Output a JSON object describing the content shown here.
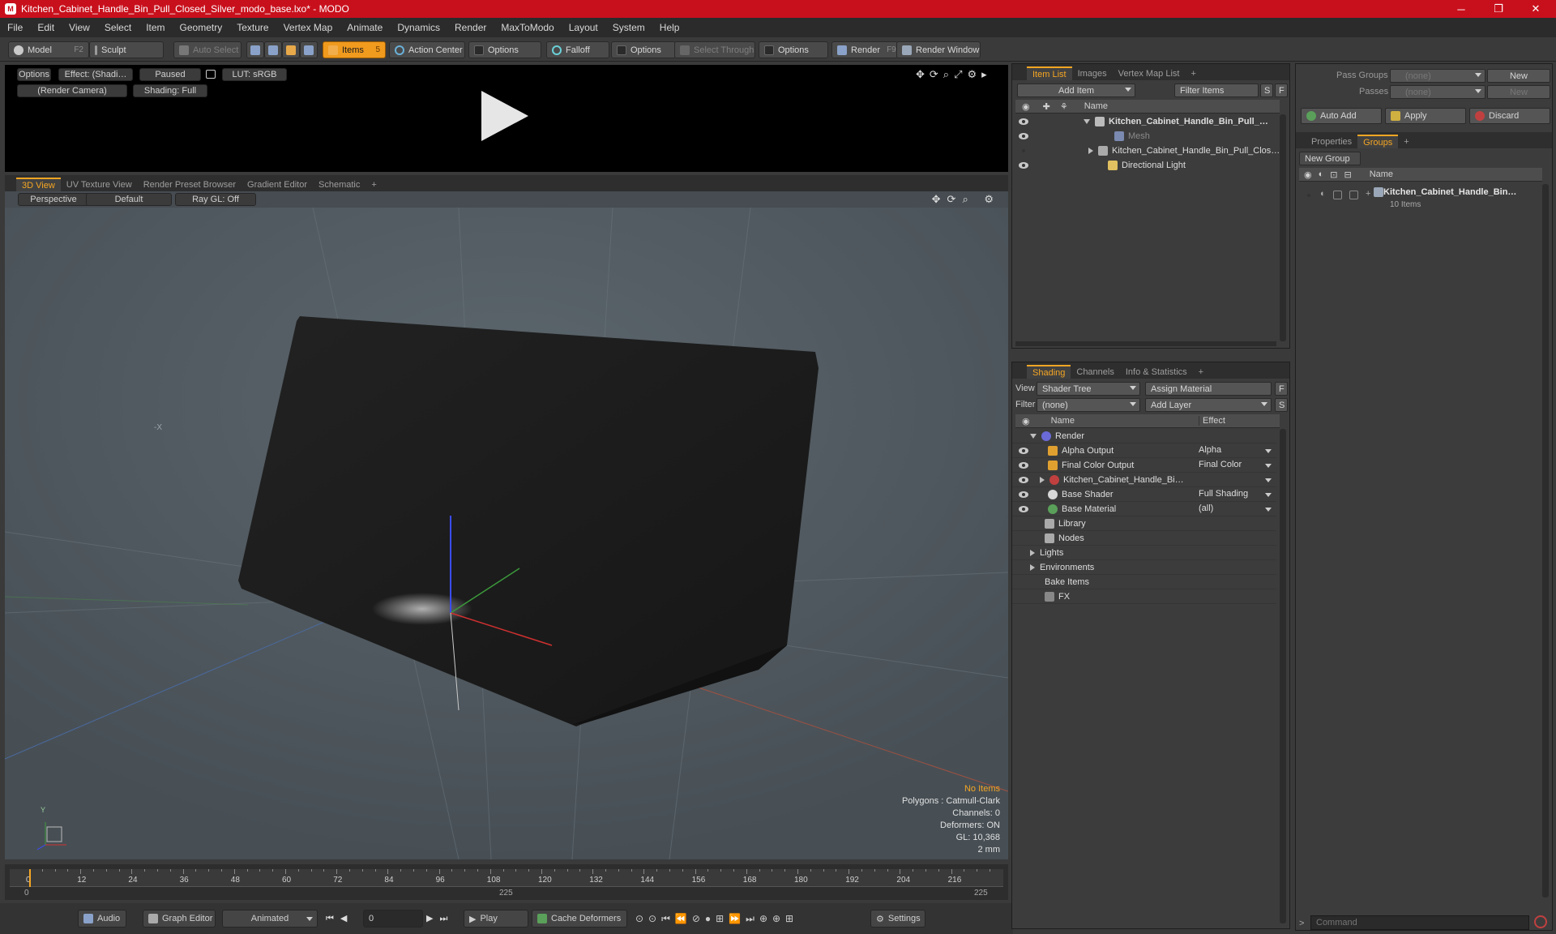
{
  "window": {
    "title": "Kitchen_Cabinet_Handle_Bin_Pull_Closed_Silver_modo_base.lxo* - MODO",
    "minimize": "─",
    "maximize": "❐",
    "close": "✕"
  },
  "menu": [
    "File",
    "Edit",
    "View",
    "Select",
    "Item",
    "Geometry",
    "Texture",
    "Vertex Map",
    "Animate",
    "Dynamics",
    "Render",
    "MaxToModo",
    "Layout",
    "System",
    "Help"
  ],
  "toolbar": {
    "model": "Model",
    "model_key": "F2",
    "sculpt": "Sculpt",
    "auto_select": "Auto Select",
    "items": "Items",
    "items_key": "5",
    "action_center": "Action Center",
    "options1": "Options",
    "falloff": "Falloff",
    "options2": "Options",
    "select_through": "Select Through",
    "options3": "Options",
    "render": "Render",
    "render_key": "F9",
    "render_window": "Render Window"
  },
  "render_preview": {
    "options": "Options",
    "effect": "Effect: (Shadi…",
    "paused": "Paused",
    "lut": "LUT: sRGB",
    "camera": "(Render Camera)",
    "shading": "Shading: Full"
  },
  "viewport_tabs": [
    "3D View",
    "UV Texture View",
    "Render Preset Browser",
    "Gradient Editor",
    "Schematic",
    "+"
  ],
  "viewport": {
    "perspective": "Perspective",
    "default": "Default",
    "raygl": "Ray GL: Off",
    "axis_x": "-X",
    "axis_y": "Y",
    "info": {
      "no_items": "No Items",
      "polygons": "Polygons : Catmull-Clark",
      "channels": "Channels: 0",
      "deformers": "Deformers: ON",
      "gl": "GL: 10,368",
      "unit": "2 mm"
    }
  },
  "timeline": {
    "ticks": [
      "0",
      "12",
      "24",
      "36",
      "48",
      "60",
      "72",
      "84",
      "96",
      "108",
      "120",
      "132",
      "144",
      "156",
      "168",
      "180",
      "192",
      "204",
      "216"
    ],
    "start": "0",
    "mid": "225",
    "end": "225"
  },
  "bottom": {
    "audio": "Audio",
    "graph_editor": "Graph Editor",
    "animated": "Animated",
    "frame": "0",
    "play": "Play",
    "cache_deformers": "Cache Deformers",
    "settings": "Settings"
  },
  "item_list": {
    "tabs": [
      "Item List",
      "Images",
      "Vertex Map List",
      "+"
    ],
    "add_item": "Add Item",
    "filter": "Filter Items",
    "s": "S",
    "f": "F",
    "col_name": "Name",
    "rows": [
      {
        "label": "Kitchen_Cabinet_Handle_Bin_Pull_…",
        "bold": true
      },
      {
        "label": "Mesh",
        "dim": true
      },
      {
        "label": "Kitchen_Cabinet_Handle_Bin_Pull_Clos…"
      },
      {
        "label": "Directional Light"
      }
    ]
  },
  "shading": {
    "tabs": [
      "Shading",
      "Channels",
      "Info & Statistics",
      "+"
    ],
    "view_label": "View",
    "view_value": "Shader Tree",
    "assign": "Assign Material",
    "filter_label": "Filter",
    "filter_value": "(none)",
    "add_layer": "Add Layer",
    "f": "F",
    "s": "S",
    "col_name": "Name",
    "col_effect": "Effect",
    "rows": [
      {
        "label": "Render",
        "effect": ""
      },
      {
        "label": "Alpha Output",
        "effect": "Alpha"
      },
      {
        "label": "Final Color Output",
        "effect": "Final Color"
      },
      {
        "label": "Kitchen_Cabinet_Handle_Bi…",
        "effect": ""
      },
      {
        "label": "Base Shader",
        "effect": "Full Shading"
      },
      {
        "label": "Base Material",
        "effect": "(all)"
      },
      {
        "label": "Library",
        "effect": ""
      },
      {
        "label": "Nodes",
        "effect": ""
      },
      {
        "label": "Lights",
        "effect": ""
      },
      {
        "label": "Environments",
        "effect": ""
      },
      {
        "label": "Bake Items",
        "effect": ""
      },
      {
        "label": "FX",
        "effect": ""
      }
    ]
  },
  "groups": {
    "pass_groups": "Pass Groups",
    "pass_value": "(none)",
    "passes": "Passes",
    "passes_value": "(none)",
    "new1": "New",
    "new2": "New",
    "auto_add": "Auto Add",
    "apply": "Apply",
    "discard": "Discard",
    "tabs": [
      "Properties",
      "Groups",
      "+"
    ],
    "new_group": "New Group",
    "col_name": "Name",
    "group_name": "Kitchen_Cabinet_Handle_Bin…",
    "group_items": "10 Items"
  },
  "command": {
    "placeholder": "Command"
  },
  "colors": {
    "accent": "#f5a623",
    "title": "#c8101c"
  }
}
